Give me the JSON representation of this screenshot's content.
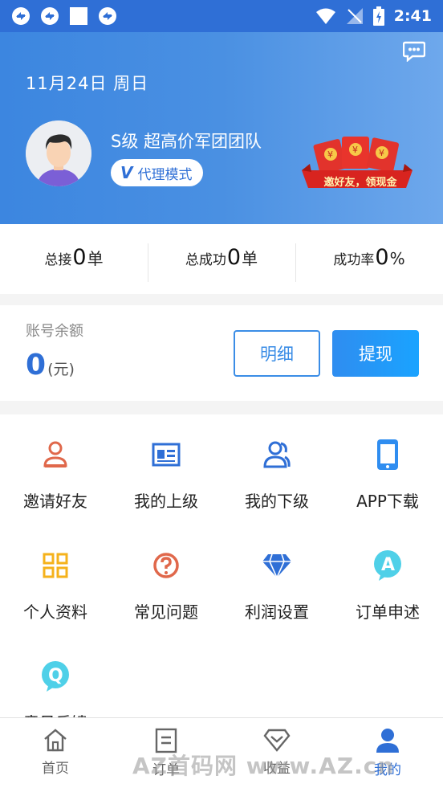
{
  "status_bar": {
    "time": "2:41"
  },
  "header": {
    "date": "11月24日 周日",
    "team_name": "S级 超高价军团团队",
    "mode_label": "代理模式",
    "invite_banner_text": "邀好友，领现金"
  },
  "stats": [
    {
      "label_pre": "总接",
      "value": "0",
      "unit": "单"
    },
    {
      "label_pre": "总成功",
      "value": "0",
      "unit": "单"
    },
    {
      "label_pre": "成功率",
      "value": "0",
      "unit": "%"
    }
  ],
  "balance": {
    "title": "账号余额",
    "value": "0",
    "unit": "(元)",
    "detail_label": "明细",
    "withdraw_label": "提现"
  },
  "grid": [
    {
      "label": "邀请好友",
      "icon": "invite-icon",
      "color": "#e0684b"
    },
    {
      "label": "我的上级",
      "icon": "id-card-icon",
      "color": "#2f6fd6"
    },
    {
      "label": "我的下级",
      "icon": "users-icon",
      "color": "#2f6fd6"
    },
    {
      "label": "APP下载",
      "icon": "phone-icon",
      "color": "#2f8df0"
    },
    {
      "label": "个人资料",
      "icon": "grid-squares-icon",
      "color": "#f5b21b"
    },
    {
      "label": "常见问题",
      "icon": "question-icon",
      "color": "#e0684b"
    },
    {
      "label": "利润设置",
      "icon": "diamond-icon",
      "color": "#2f6fd6"
    },
    {
      "label": "订单申述",
      "icon": "appeal-a-icon",
      "color": "#4fd0e8"
    },
    {
      "label": "意见反馈",
      "icon": "feedback-q-icon",
      "color": "#4fd0e8"
    }
  ],
  "tabs": [
    {
      "label": "首页",
      "icon": "home-icon",
      "active": false
    },
    {
      "label": "订单",
      "icon": "order-icon",
      "active": false
    },
    {
      "label": "收益",
      "icon": "earnings-icon",
      "active": false
    },
    {
      "label": "我的",
      "icon": "profile-icon",
      "active": true
    }
  ],
  "watermark": "AZ首码网 www.AZ.cn",
  "colors": {
    "primary": "#2f6fd6",
    "header_start": "#3c86e0",
    "header_end": "#6ea8ec",
    "accent_red": "#e0684b",
    "accent_yellow": "#f5b21b",
    "accent_cyan": "#4fd0e8"
  }
}
